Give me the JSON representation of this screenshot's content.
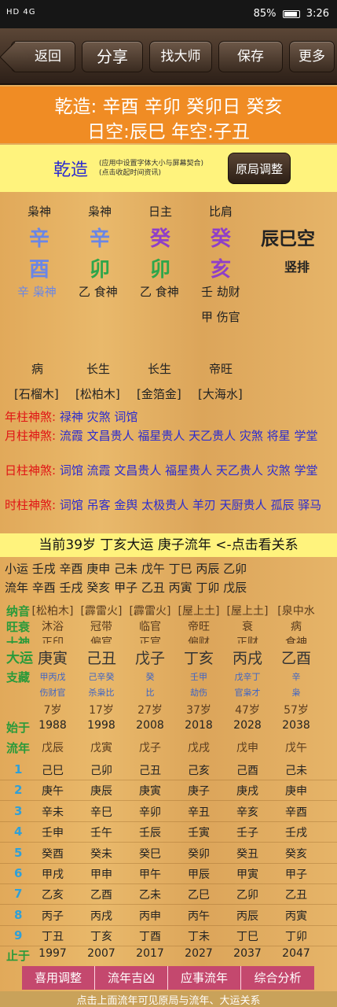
{
  "status_bar": {
    "network": "HD 4G",
    "battery": "85%",
    "time": "3:26"
  },
  "toolbar": {
    "back": "返回",
    "share": "分享",
    "find_master": "找大师",
    "save": "保存",
    "more": "更多"
  },
  "banner": {
    "line1": "乾造: 辛酉 辛卯 癸卯日 癸亥",
    "line2": "日空:辰巳 年空:子丑"
  },
  "chart_header": {
    "title": "乾造",
    "hint1": "(应用中设置字体大小与屏幕契合)",
    "hint2": "(点击收起时间资讯)",
    "adjust_button": "原局调整"
  },
  "pillars": [
    {
      "shishen": "枭神",
      "stem": "辛",
      "branch": "酉",
      "hidden": [
        "辛 枭神"
      ]
    },
    {
      "shishen": "枭神",
      "stem": "辛",
      "branch": "卯",
      "hidden": [
        "乙 食神"
      ]
    },
    {
      "shishen": "日主",
      "stem": "癸",
      "branch": "卯",
      "hidden": [
        "乙 食神"
      ]
    },
    {
      "shishen": "比肩",
      "stem": "癸",
      "branch": "亥",
      "hidden": [
        "壬 劫财",
        "甲 伤官"
      ]
    }
  ],
  "kongwang": "辰巳空",
  "vertical_layout": "竖排",
  "life_stages": [
    "病",
    "长生",
    "长生",
    "帝旺"
  ],
  "nayin": [
    "[石榴木]",
    "[松柏木]",
    "[金箔金]",
    "[大海水]"
  ],
  "shensha": [
    {
      "label": "年柱神煞:",
      "value": "禄神 灾煞 词馆"
    },
    {
      "label": "月柱神煞:",
      "value": "流霞 文昌贵人 福星贵人 天乙贵人 灾煞 将星 学堂"
    },
    {
      "label": "日柱神煞:",
      "value": "词馆 流霞 文昌贵人 福星贵人 天乙贵人 灾煞 学堂"
    },
    {
      "label": "时柱神煞:",
      "value": "词馆 吊客 金舆 太极贵人 羊刃 天厨贵人 孤辰 驿马"
    }
  ],
  "current": "当前39岁 丁亥大运 庚子流年   <-点击看关系",
  "xiaoyun": "小运  壬戌 辛酉 庚申 己未 戊午 丁巳 丙辰 乙卯",
  "liunian_line": "流年  辛酉 壬戌 癸亥 甲子 乙丑 丙寅 丁卯 戊辰",
  "dayun_table": {
    "labels": {
      "nayin": "纳音",
      "wangshuai": "旺衰",
      "shishen": "十神",
      "dayun": "大运",
      "zhicang": "支藏",
      "start": "始于",
      "liunian": "流年",
      "end": "止于"
    },
    "nayin": [
      "[松柏木]",
      "[霹雷火]",
      "[霹雷火]",
      "[屋上土]",
      "[屋上土]",
      "[泉中水"
    ],
    "wangshuai": [
      "沐浴",
      "冠带",
      "临官",
      "帝旺",
      "衰",
      "病"
    ],
    "shishen": [
      "正印",
      "偏官",
      "正官",
      "偏财",
      "正财",
      "食神"
    ],
    "dayun": [
      "庚寅",
      "己丑",
      "戊子",
      "丁亥",
      "丙戌",
      "乙酉"
    ],
    "zhicang1": [
      "甲丙戊",
      "己辛癸",
      "癸",
      "壬甲",
      "戊辛丁",
      "辛"
    ],
    "zhicang2": [
      "伤财官",
      "杀枭比",
      "比",
      "劫伤",
      "官枭才",
      "枭"
    ],
    "ages": [
      "7岁",
      "17岁",
      "27岁",
      "37岁",
      "47岁",
      "57岁"
    ],
    "start": [
      "1988",
      "1998",
      "2008",
      "2018",
      "2028",
      "2038"
    ],
    "liunian_head": [
      "戊辰",
      "戊寅",
      "戊子",
      "戊戌",
      "戊申",
      "戊午"
    ],
    "rows": [
      {
        "idx": "1",
        "cells": [
          "己巳",
          "己卯",
          "己丑",
          "己亥",
          "己酉",
          "己未"
        ]
      },
      {
        "idx": "2",
        "cells": [
          "庚午",
          "庚辰",
          "庚寅",
          "庚子",
          "庚戌",
          "庚申"
        ]
      },
      {
        "idx": "3",
        "cells": [
          "辛未",
          "辛巳",
          "辛卯",
          "辛丑",
          "辛亥",
          "辛酉"
        ]
      },
      {
        "idx": "4",
        "cells": [
          "壬申",
          "壬午",
          "壬辰",
          "壬寅",
          "壬子",
          "壬戌"
        ]
      },
      {
        "idx": "5",
        "cells": [
          "癸酉",
          "癸未",
          "癸巳",
          "癸卯",
          "癸丑",
          "癸亥"
        ]
      },
      {
        "idx": "6",
        "cells": [
          "甲戌",
          "甲申",
          "甲午",
          "甲辰",
          "甲寅",
          "甲子"
        ]
      },
      {
        "idx": "7",
        "cells": [
          "乙亥",
          "乙酉",
          "乙未",
          "乙巳",
          "乙卯",
          "乙丑"
        ]
      },
      {
        "idx": "8",
        "cells": [
          "丙子",
          "丙戌",
          "丙申",
          "丙午",
          "丙辰",
          "丙寅"
        ]
      },
      {
        "idx": "9",
        "cells": [
          "丁丑",
          "丁亥",
          "丁酉",
          "丁未",
          "丁巳",
          "丁卯"
        ]
      }
    ],
    "end": [
      "1997",
      "2007",
      "2017",
      "2027",
      "2037",
      "2047"
    ]
  },
  "bottom_tabs": [
    "喜用调整",
    "流年吉凶",
    "应事流年",
    "综合分析"
  ],
  "footer_hint": "点击上面流年可见原局与流年、大运关系"
}
